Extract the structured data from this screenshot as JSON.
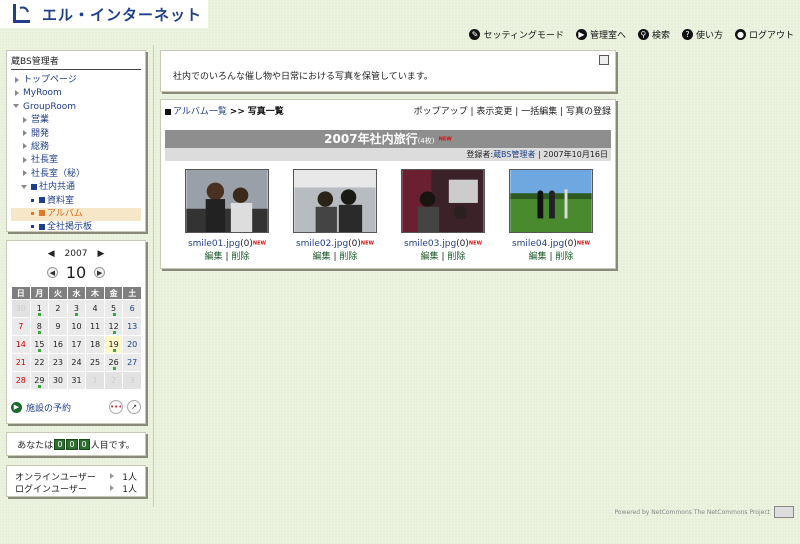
{
  "header": {
    "logo_text": "エル・インターネット",
    "nav": [
      {
        "label": "セッティングモード",
        "icon": "wrench-icon"
      },
      {
        "label": "管理室へ",
        "icon": "arrow-right-icon"
      },
      {
        "label": "検索",
        "icon": "search-icon"
      },
      {
        "label": "使い方",
        "icon": "help-icon"
      },
      {
        "label": "ログアウト",
        "icon": "user-icon"
      }
    ]
  },
  "sidebar": {
    "title": "蔵BS管理者",
    "items": [
      {
        "label": "トップページ"
      },
      {
        "label": "MyRoom"
      },
      {
        "label": "GroupRoom"
      },
      {
        "label": "営業"
      },
      {
        "label": "開発"
      },
      {
        "label": "総務"
      },
      {
        "label": "社長室"
      },
      {
        "label": "社長室（秘）"
      },
      {
        "label": "社内共通"
      },
      {
        "label": "資料室"
      },
      {
        "label": "アルバム"
      },
      {
        "label": "全社掲示板"
      }
    ]
  },
  "calendar": {
    "year": "2007",
    "month": "10",
    "weekdays": [
      "日",
      "月",
      "火",
      "水",
      "木",
      "金",
      "土"
    ],
    "weeks": [
      [
        "30",
        "1",
        "2",
        "3",
        "4",
        "5",
        "6"
      ],
      [
        "7",
        "8",
        "9",
        "10",
        "11",
        "12",
        "13"
      ],
      [
        "14",
        "15",
        "16",
        "17",
        "18",
        "19",
        "20"
      ],
      [
        "21",
        "22",
        "23",
        "24",
        "25",
        "26",
        "27"
      ],
      [
        "28",
        "29",
        "30",
        "31",
        "1",
        "2",
        "3"
      ]
    ],
    "reserve_label": "施設の予約"
  },
  "counter": {
    "prefix": "あなたは",
    "digits": [
      "0",
      "0",
      "0"
    ],
    "suffix": "人目です。"
  },
  "online": {
    "rows": [
      {
        "label": "オンラインユーザー",
        "value": "1人"
      },
      {
        "label": "ログインユーザー",
        "value": "1人"
      }
    ]
  },
  "description": "社内でのいろんな催し物や日常における写真を保管しています。",
  "album": {
    "crumb_link": "アルバム一覧",
    "crumb_sep": ">>",
    "crumb_current": "写真一覧",
    "actions": [
      "ポップアップ",
      "表示変更",
      "一括編集",
      "写真の登録"
    ],
    "title": "2007年社内旅行",
    "count": "(4枚)",
    "new_mark": "NEW",
    "registrant_label": "登録者:",
    "registrant": "蔵BS管理者",
    "date": "2007年10月16日",
    "edit_label": "編集",
    "delete_label": "削除",
    "photos": [
      {
        "name": "smile01.jpg",
        "comments": "(0)"
      },
      {
        "name": "smile02.jpg",
        "comments": "(0)"
      },
      {
        "name": "smile03.jpg",
        "comments": "(0)"
      },
      {
        "name": "smile04.jpg",
        "comments": "(0)"
      }
    ]
  },
  "footer": {
    "text": "Powered by NetCommons  The NetCommons Project"
  }
}
